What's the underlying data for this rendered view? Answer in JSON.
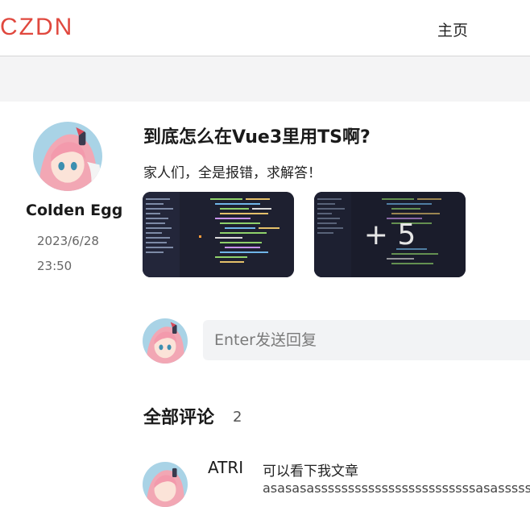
{
  "header": {
    "logo_text": "CZDN",
    "nav_home": "主页",
    "brand_color": "#e0483e"
  },
  "post": {
    "author_name": "Colden Egg",
    "date": "2023/6/28",
    "time": "23:50",
    "title": "到底怎么在Vue3里用TS啊?",
    "body": "家人们，全是报错，求解答！",
    "more_images_label": "+ 5"
  },
  "reply": {
    "placeholder": "Enter发送回复"
  },
  "comments": {
    "heading": "全部评论",
    "count": "2",
    "items": [
      {
        "author": "ATRI",
        "text": "可以看下我文章",
        "text_2": "asasasassssssssssssssssssssssssasasssss"
      }
    ]
  },
  "icons": {
    "avatar": "anime-avatar-icon",
    "thumbnail": "code-screenshot-icon"
  }
}
